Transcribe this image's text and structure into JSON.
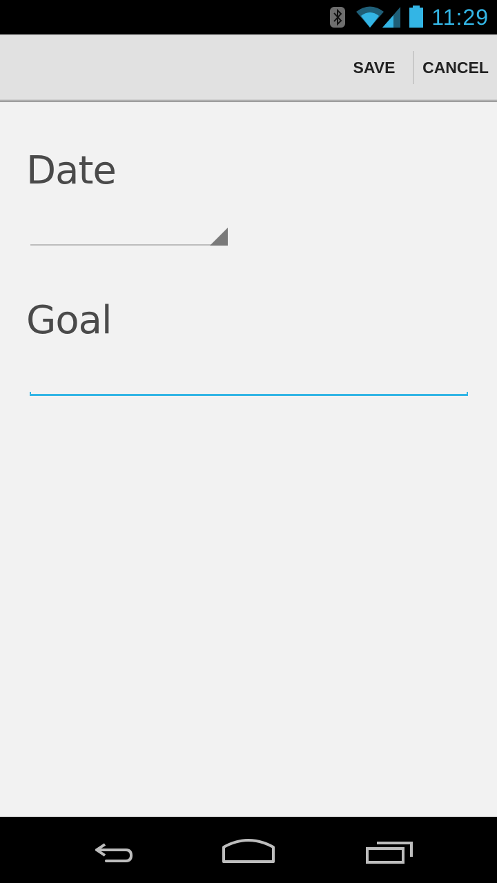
{
  "status_bar": {
    "time": "11:29",
    "icons": [
      "bluetooth-icon",
      "wifi-icon",
      "signal-icon",
      "battery-icon"
    ],
    "accent_color": "#33b5e5"
  },
  "action_bar": {
    "save_label": "SAVE",
    "cancel_label": "CANCEL"
  },
  "form": {
    "date_label": "Date",
    "date_value": "",
    "goal_label": "Goal",
    "goal_value": ""
  },
  "nav_bar": {
    "icons": [
      "back-icon",
      "home-icon",
      "recents-icon"
    ]
  }
}
